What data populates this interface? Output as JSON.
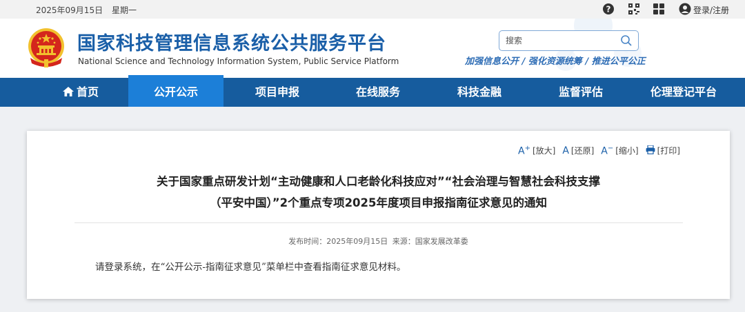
{
  "topbar": {
    "date": "2025年09月15日",
    "weekday": "星期一",
    "icons": [
      "help-icon",
      "qrcode-icon",
      "apps-icon",
      "user-icon"
    ],
    "login_label": "登录/注册"
  },
  "header": {
    "title": "国家科技管理信息系统公共服务平台",
    "subtitle": "National Science and Technology Information System, Public Service Platform",
    "search_placeholder": "搜索",
    "slogan": "加强信息公开 / 强化资源统筹 / 推进公平公正"
  },
  "nav": {
    "items": [
      {
        "label": "首页",
        "icon": "home-icon"
      },
      {
        "label": "公开公示",
        "active": true
      },
      {
        "label": "项目申报"
      },
      {
        "label": "在线服务"
      },
      {
        "label": "科技金融"
      },
      {
        "label": "监督评估"
      },
      {
        "label": "伦理登记平台"
      }
    ]
  },
  "article": {
    "tools": [
      {
        "label": "[放大]",
        "icon": "zoom-in-icon"
      },
      {
        "label": "[还原]",
        "icon": "text-reset-icon"
      },
      {
        "label": "[缩小]",
        "icon": "zoom-out-icon"
      },
      {
        "label": "[打印]",
        "icon": "print-icon"
      }
    ],
    "title_line1": "关于国家重点研发计划“主动健康和人口老龄化科技应对”“社会治理与智慧社会科技支撑",
    "title_line2": "（平安中国）”2个重点专项2025年度项目申报指南征求意见的通知",
    "publish_time": "发布时间：2025年09月15日",
    "source": "来源：国家发展改革委",
    "body": "请登录系统，在“公开公示-指南征求意见”菜单栏中查看指南征求意见材料。"
  },
  "colors": {
    "nav_bg": "#165c9e",
    "nav_active": "#1c7fd8",
    "title_blue": "#1a5fa8",
    "emblem_red": "#d4261c",
    "emblem_gold": "#f2c12e"
  }
}
